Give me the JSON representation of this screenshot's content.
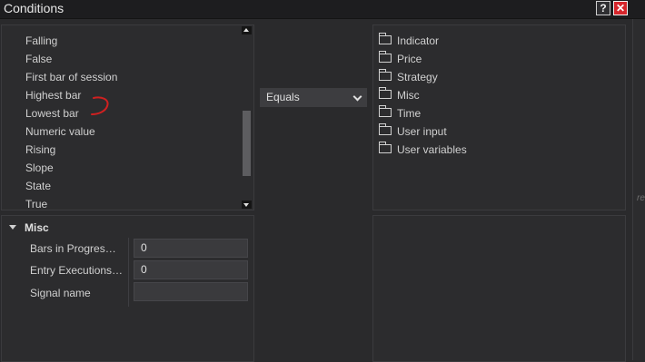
{
  "window": {
    "title": "Conditions",
    "help_label": "?",
    "close_label": "✕"
  },
  "condition_list": {
    "items": [
      "Falling",
      "False",
      "First bar of session",
      "Highest bar",
      "Lowest bar",
      "Numeric value",
      "Rising",
      "Slope",
      "State",
      "True"
    ]
  },
  "properties": {
    "section_label": "Misc",
    "rows": [
      {
        "label": "Bars in Progres…",
        "value": "0"
      },
      {
        "label": "Entry Executions…",
        "value": "0"
      },
      {
        "label": "Signal name",
        "value": ""
      }
    ]
  },
  "operator": {
    "selected": "Equals"
  },
  "category_tree": {
    "items": [
      "Indicator",
      "Price",
      "Strategy",
      "Misc",
      "Time",
      "User input",
      "User variables"
    ]
  },
  "edge_strip": {
    "text": "re"
  },
  "colors": {
    "background": "#2a2a2c",
    "panel": "#2c2c2e",
    "close_button": "#d6262c",
    "annotation_stroke": "#d02020"
  }
}
